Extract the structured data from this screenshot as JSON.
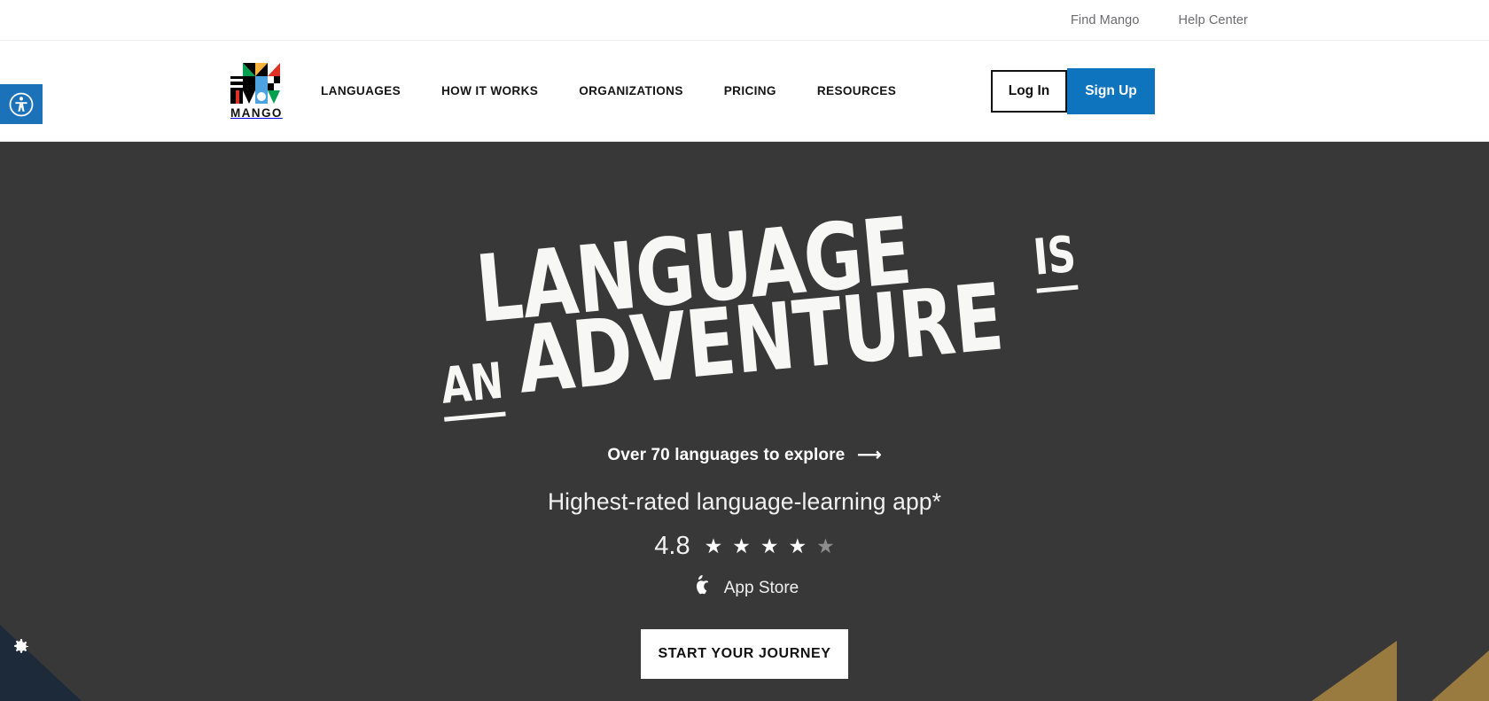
{
  "utility_bar": {
    "links": [
      {
        "label": "Find Mango"
      },
      {
        "label": "Help Center"
      }
    ]
  },
  "header": {
    "brand": {
      "wordmark": "MANGO"
    },
    "nav": [
      {
        "label": "LANGUAGES"
      },
      {
        "label": "HOW IT WORKS"
      },
      {
        "label": "ORGANIZATIONS"
      },
      {
        "label": "PRICING"
      },
      {
        "label": "RESOURCES"
      }
    ],
    "login_label": "Log In",
    "signup_label": "Sign Up",
    "signup_color": "#0d74bd"
  },
  "hero": {
    "background_color": "#383838",
    "headline": {
      "line1_main": "LANGUAGE",
      "line1_small": "IS",
      "line2_small": "AN",
      "line2_main": "ADVENTURE"
    },
    "languages_link": "Over 70 languages to explore",
    "arrow_glyph": "⟶",
    "tagline": "Highest-rated language-learning app*",
    "rating": {
      "value": "4.8",
      "stars": [
        {
          "glyph": "★",
          "state": "full"
        },
        {
          "glyph": "★",
          "state": "full"
        },
        {
          "glyph": "★",
          "state": "full"
        },
        {
          "glyph": "★",
          "state": "full"
        },
        {
          "glyph": "★",
          "state": "partial"
        }
      ],
      "store_label": "App Store"
    },
    "cta_label": "START YOUR JOURNEY"
  },
  "accessibility": {
    "badge_color": "#1b72b8",
    "badge_icon": "accessibility-icon",
    "settings_icon": "gear-icon"
  }
}
